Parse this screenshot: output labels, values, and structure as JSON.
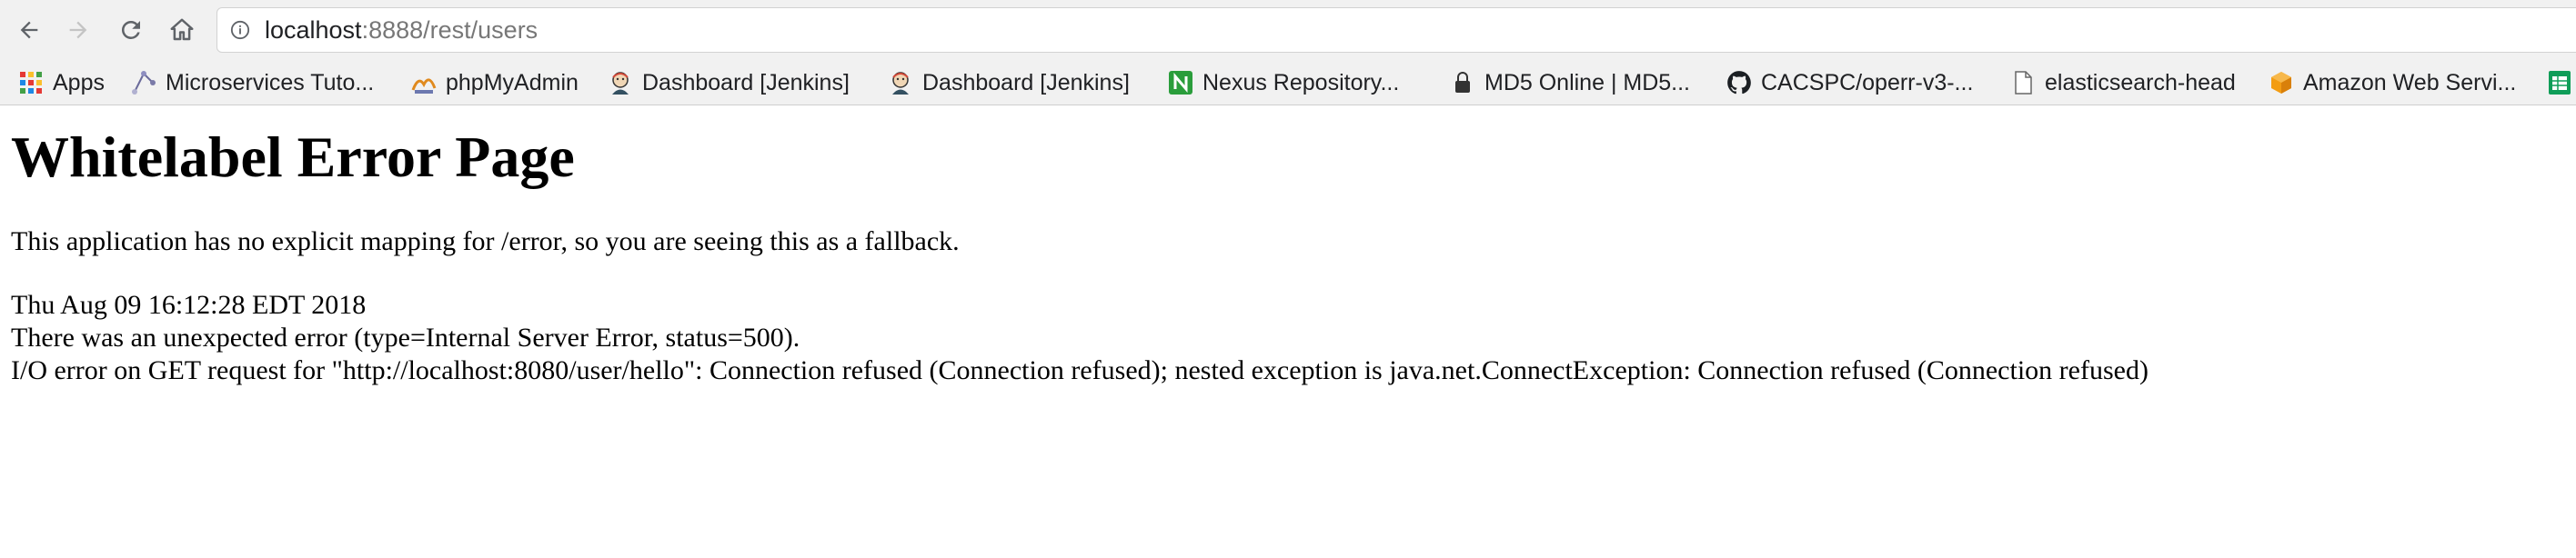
{
  "address_bar": {
    "url_host": "localhost",
    "url_rest": ":8888/rest/users"
  },
  "bookmarks": [
    {
      "label": "Apps",
      "icon": "apps-grid-icon"
    },
    {
      "label": "Microservices Tuto...",
      "icon": "microservices-icon"
    },
    {
      "label": "phpMyAdmin",
      "icon": "phpmyadmin-icon"
    },
    {
      "label": "Dashboard [Jenkins]",
      "icon": "jenkins-icon"
    },
    {
      "label": "Dashboard [Jenkins]",
      "icon": "jenkins-icon"
    },
    {
      "label": "Nexus Repository...",
      "icon": "nexus-icon"
    },
    {
      "label": "MD5 Online | MD5...",
      "icon": "lock-icon"
    },
    {
      "label": "CACSPC/operr-v3-...",
      "icon": "github-icon"
    },
    {
      "label": "elasticsearch-head",
      "icon": "document-icon"
    },
    {
      "label": "Amazon Web Servi...",
      "icon": "aws-icon"
    }
  ],
  "page": {
    "title": "Whitelabel Error Page",
    "explanation": "This application has no explicit mapping for /error, so you are seeing this as a fallback.",
    "timestamp": "Thu Aug 09 16:12:28 EDT 2018",
    "error_line": "There was an unexpected error (type=Internal Server Error, status=500).",
    "detail_line": "I/O error on GET request for \"http://localhost:8080/user/hello\": Connection refused (Connection refused); nested exception is java.net.ConnectException: Connection refused (Connection refused)"
  },
  "colors": {
    "toolbar_bg": "#f1f1f1",
    "nexus_green": "#2a9d3b",
    "apps_red": "#e53935",
    "apps_yellow": "#fbc02d",
    "apps_green": "#43a047",
    "apps_blue": "#1e88e5",
    "aws_orange": "#f39c12"
  }
}
